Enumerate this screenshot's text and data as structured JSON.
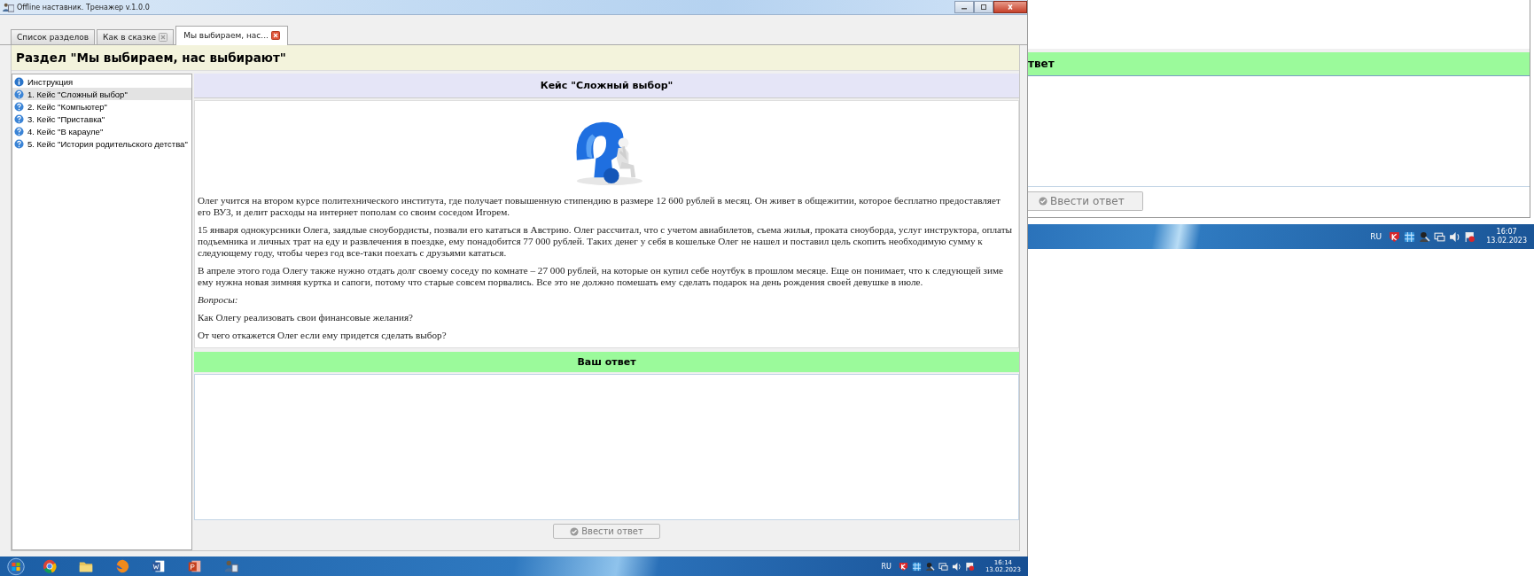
{
  "window": {
    "title": "Offline наставник. Тренажер v.1.0.0"
  },
  "tabs": [
    {
      "label": "Список разделов",
      "selected": false,
      "closable": false
    },
    {
      "label": "Как в сказке",
      "selected": false,
      "closable": true
    },
    {
      "label": "Мы выбираем, нас...",
      "selected": true,
      "closable": true
    }
  ],
  "section_title": "Раздел \"Мы выбираем, нас выбирают\"",
  "sidebar": {
    "items": [
      {
        "label": "Инструкция",
        "kind": "info",
        "selected": false
      },
      {
        "label": "1. Кейс \"Сложный выбор\"",
        "kind": "question",
        "selected": true
      },
      {
        "label": "2. Кейс \"Компьютер\"",
        "kind": "question",
        "selected": false
      },
      {
        "label": "3. Кейс \"Приставка\"",
        "kind": "question",
        "selected": false
      },
      {
        "label": "4. Кейс \"В карауле\"",
        "kind": "question",
        "selected": false
      },
      {
        "label": "5. Кейс \"История родительского детства\"",
        "kind": "question",
        "selected": false
      }
    ]
  },
  "case": {
    "title": "Кейс \"Сложный выбор\"",
    "paragraphs": [
      {
        "kind": "plain",
        "text": "Олег учится на втором курсе политехнического института, где получает повышенную стипендию в размере 12 600 рублей в месяц. Он живет в общежитии, которое бесплатно предоставляет его ВУЗ, и делит расходы на интернет пополам со своим соседом Игорем."
      },
      {
        "kind": "plain",
        "text": "15 января однокурсники Олега, заядлые сноубордисты, позвали его кататься в Австрию. Олег рассчитал, что с учетом авиабилетов, съема жилья, проката сноуборда, услуг инструктора, оплаты подъемника и личных трат на еду и развлечения в поездке, ему понадобится 77 000 рублей. Таких денег у себя в кошельке Олег не нашел и поставил цель скопить необходимую сумму к следующему году, чтобы через год все-таки поехать с друзьями кататься."
      },
      {
        "kind": "plain",
        "text": "В апреле этого года Олегу также нужно отдать долг своему соседу по комнате – 27 000 рублей, на которые он купил себе ноутбук в прошлом месяце. Еще он понимает, что к следующей зиме ему нужна новая зимняя куртка и сапоги, потому что старые совсем порвались. Все это не должно помешать ему сделать подарок на день рождения своей девушке в июле."
      },
      {
        "kind": "italic",
        "text": "Вопросы:"
      },
      {
        "kind": "plain",
        "text": "Как Олегу реализовать свои финансовые желания?"
      },
      {
        "kind": "plain",
        "text": "От чего откажется Олег если ему придется сделать выбор?"
      }
    ]
  },
  "answer": {
    "title": "Ваш ответ",
    "button": {
      "label": "Ввести ответ",
      "disabled": true
    }
  },
  "taskbar": {
    "apps": [
      {
        "kind": "start"
      },
      {
        "kind": "chrome"
      },
      {
        "kind": "folder"
      },
      {
        "kind": "firefox"
      },
      {
        "kind": "word"
      },
      {
        "kind": "powerpoint"
      },
      {
        "kind": "app"
      }
    ],
    "language": "RU",
    "time": "16:14",
    "date": "13.02.2023"
  },
  "background_window": {
    "answer_title": "твет",
    "button": {
      "label": "Ввести ответ",
      "disabled": true
    },
    "taskbar": {
      "language": "RU",
      "time": "16:07",
      "date": "13.02.2023"
    }
  }
}
